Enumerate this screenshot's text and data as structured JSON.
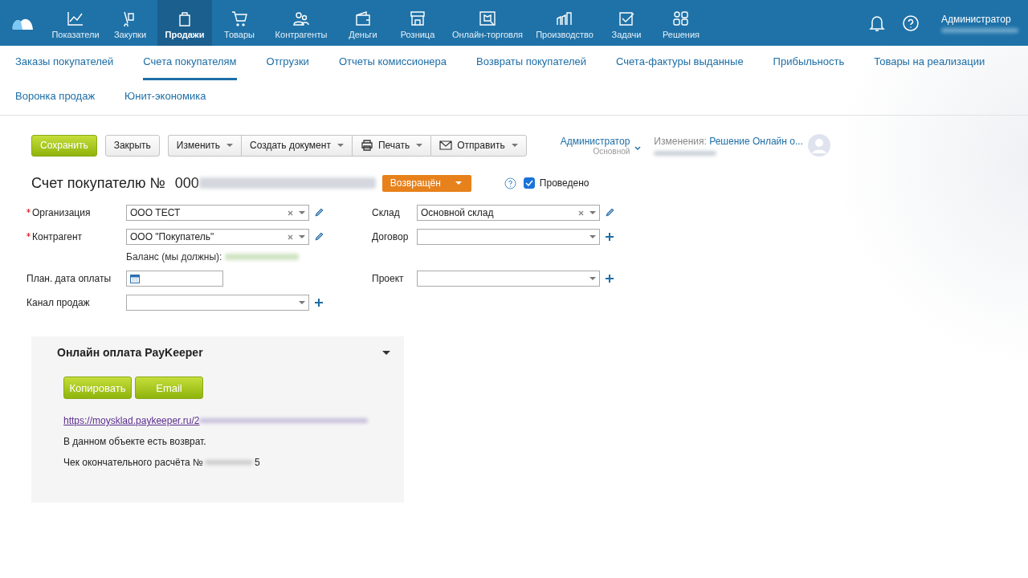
{
  "topnav": {
    "items": [
      {
        "label": "Показатели",
        "selected": false
      },
      {
        "label": "Закупки",
        "selected": false
      },
      {
        "label": "Продажи",
        "selected": true
      },
      {
        "label": "Товары",
        "selected": false
      },
      {
        "label": "Контрагенты",
        "selected": false
      },
      {
        "label": "Деньги",
        "selected": false
      },
      {
        "label": "Розница",
        "selected": false
      },
      {
        "label": "Онлайн-торговля",
        "selected": false
      },
      {
        "label": "Производство",
        "selected": false
      },
      {
        "label": "Задачи",
        "selected": false
      },
      {
        "label": "Решения",
        "selected": false
      }
    ],
    "user": "Администратор"
  },
  "subnav": [
    {
      "label": "Заказы покупателей",
      "selected": false
    },
    {
      "label": "Счета покупателям",
      "selected": true
    },
    {
      "label": "Отгрузки",
      "selected": false
    },
    {
      "label": "Отчеты комиссионера",
      "selected": false
    },
    {
      "label": "Возвраты покупателей",
      "selected": false
    },
    {
      "label": "Счета-фактуры выданные",
      "selected": false
    },
    {
      "label": "Прибыльность",
      "selected": false
    },
    {
      "label": "Товары на реализации",
      "selected": false
    },
    {
      "label": "Воронка продаж",
      "selected": false
    },
    {
      "label": "Юнит-экономика",
      "selected": false
    }
  ],
  "toolbar": {
    "save": "Сохранить",
    "close": "Закрыть",
    "menus": [
      "Изменить",
      "Создать документ",
      "Печать",
      "Отправить"
    ],
    "owner": "Администратор",
    "owner_group": "Основной",
    "changes_label": "Изменения:",
    "changes_value": "Решение Онлайн о..."
  },
  "document": {
    "title": "Счет покупателю №",
    "number": "000",
    "status": "Возвращён",
    "posted_label": "Проведено",
    "posted": true
  },
  "fields_left": [
    {
      "label": "Организация",
      "required": true,
      "value": "ООО ТЕСТ",
      "kind": "select"
    },
    {
      "label": "Контрагент",
      "required": true,
      "value": "ООО \"Покупатель\"",
      "kind": "select",
      "note": "Баланс (мы должны):"
    },
    {
      "label": "План. дата оплаты",
      "required": false,
      "kind": "date"
    },
    {
      "label": "Канал продаж",
      "required": false,
      "kind": "select-add"
    }
  ],
  "fields_right": [
    {
      "label": "Склад",
      "value": "Основной склад",
      "kind": "select"
    },
    {
      "label": "Договор",
      "kind": "select-add"
    },
    {
      "label": "Проект",
      "kind": "select-add"
    }
  ],
  "panel": {
    "title": "Онлайн оплата PayKeeper",
    "buttons": [
      "Копировать",
      "Email"
    ],
    "link": "https://moysklad.paykeeper.ru/2",
    "lines": [
      "В данном объекте есть возврат.",
      "Чек окончательного расчёта №"
    ],
    "receipt_tail": "5"
  }
}
